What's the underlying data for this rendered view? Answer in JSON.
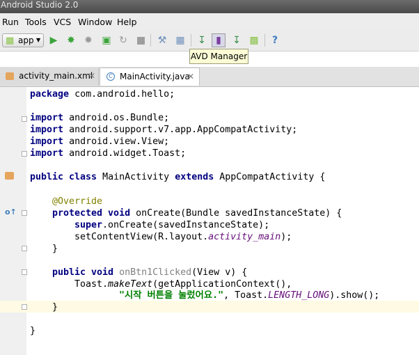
{
  "window": {
    "title": "Android Studio 2.0"
  },
  "menu": [
    "Run",
    "Tools",
    "VCS",
    "Window",
    "Help"
  ],
  "toolbar": {
    "run_config": "app",
    "tooltip": "AVD Manager"
  },
  "tabs": [
    {
      "label": "activity_main.xml",
      "active": false
    },
    {
      "label": "MainActivity.java",
      "active": true
    }
  ],
  "code": {
    "package": "com.android.hello;",
    "imports": [
      "android.os.Bundle;",
      "android.support.v7.app.AppCompatActivity;",
      "android.view.View;",
      "android.widget.Toast;"
    ],
    "class_name": "MainActivity",
    "extends_name": "AppCompatActivity {",
    "annotation": "@Override",
    "oncreate_sig": " onCreate(Bundle savedInstanceState) {",
    "super_call": ".onCreate(savedInstanceState);",
    "setcontent_pre": "setContentView(R.layout.",
    "layout_field": "activity_main",
    "setcontent_post": ");",
    "method_name": "onBtn1Clicked",
    "method_params": "(View v) {",
    "toast_pre": "Toast.",
    "toast_method": "makeText",
    "toast_args": "(getApplicationContext(),",
    "toast_string": "\"시작 버튼을 눌렀어요.\"",
    "toast_mid": ", Toast.",
    "toast_field": "LENGTH_LONG",
    "toast_post": ").show();",
    "close_brace": "}"
  }
}
